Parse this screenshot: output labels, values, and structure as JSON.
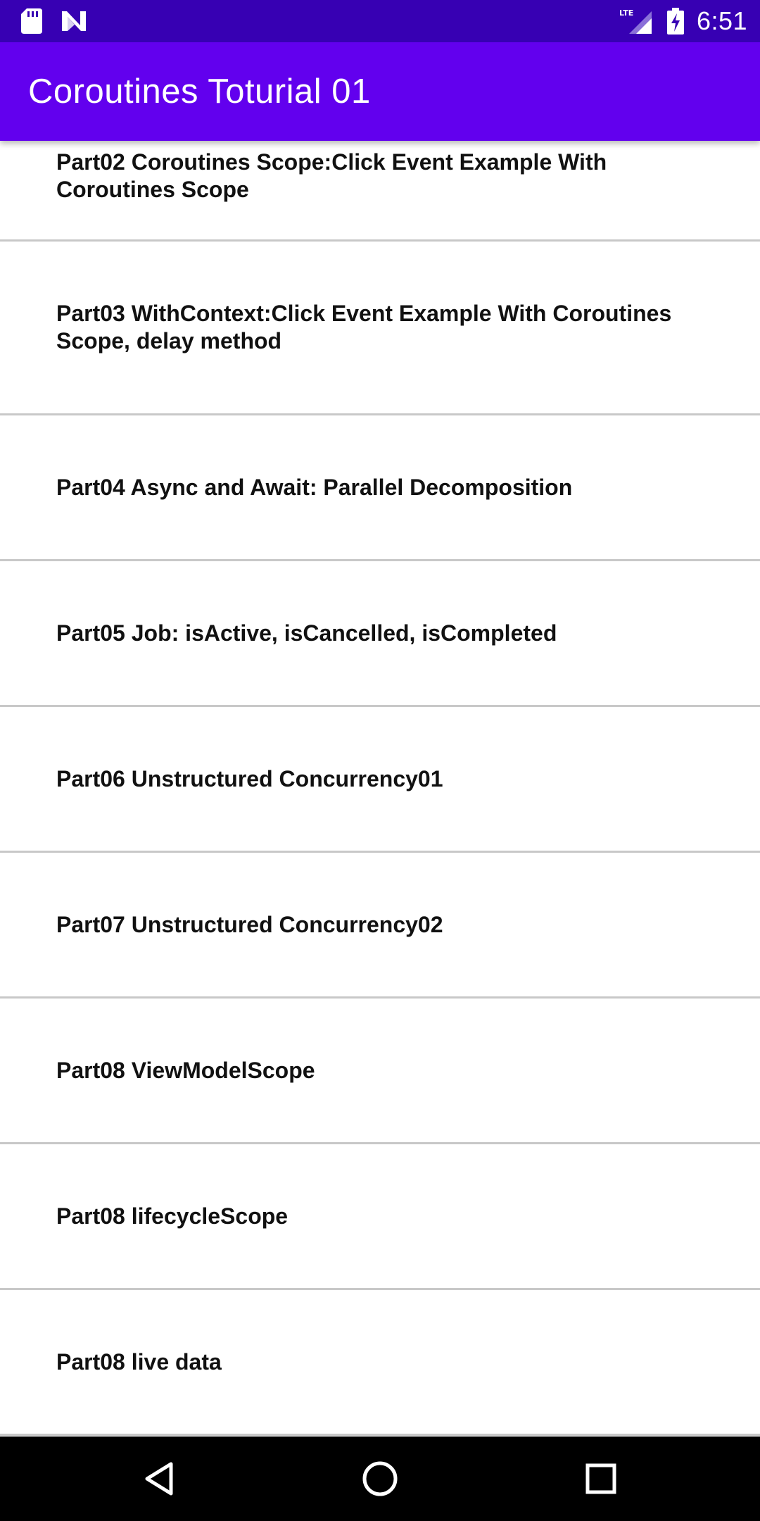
{
  "status_bar": {
    "time": "6:51",
    "network": "LTE",
    "icons": [
      "sd-card-icon",
      "n-notification-icon",
      "lte-signal-icon",
      "battery-charging-icon"
    ]
  },
  "app_bar": {
    "title": "Coroutines Toturial 01",
    "color": "#6200ee"
  },
  "list": {
    "items": [
      {
        "label": "Part02 Coroutines Scope:Click Event Example With Coroutines Scope"
      },
      {
        "label": "Part03 WithContext:Click Event Example With Coroutines Scope, delay method"
      },
      {
        "label": "Part04 Async and Await: Parallel Decomposition"
      },
      {
        "label": "Part05 Job: isActive, isCancelled, isCompleted"
      },
      {
        "label": "Part06 Unstructured Concurrency01"
      },
      {
        "label": "Part07 Unstructured Concurrency02"
      },
      {
        "label": "Part08 ViewModelScope"
      },
      {
        "label": "Part08 lifecycleScope"
      },
      {
        "label": "Part08 live data"
      }
    ]
  },
  "nav_bar": {
    "buttons": [
      "back-icon",
      "home-icon",
      "recents-icon"
    ]
  },
  "colors": {
    "status_bar": "#3700b3",
    "app_bar": "#6200ee",
    "divider": "#c8c8c8",
    "nav_bar": "#000000"
  }
}
